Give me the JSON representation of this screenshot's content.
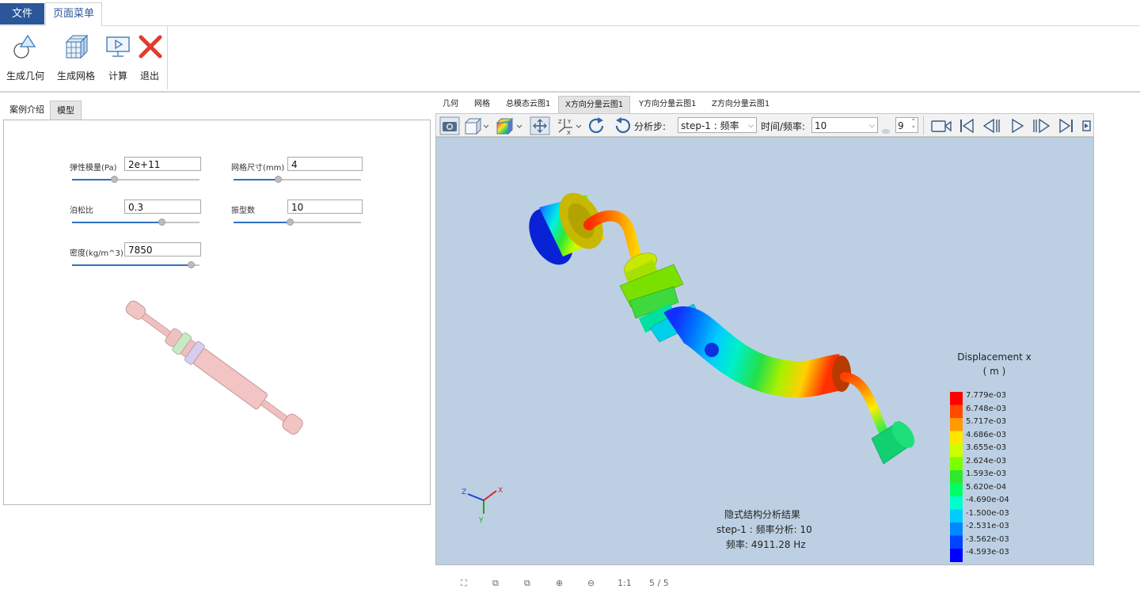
{
  "menu": {
    "file": "文件",
    "page_menu": "页面菜单"
  },
  "ribbon": {
    "buttons": [
      {
        "label": "生成几何",
        "icon": "geometry-icon"
      },
      {
        "label": "生成网格",
        "icon": "mesh-icon"
      },
      {
        "label": "计算",
        "icon": "compute-icon"
      },
      {
        "label": "退出",
        "icon": "exit-icon"
      }
    ]
  },
  "left": {
    "tabs": [
      "案例介绍",
      "模型"
    ],
    "active_tab": "模型",
    "params": {
      "elastic_modulus": {
        "label": "弹性模量(Pa)",
        "value": "2e+11",
        "slider": 0.32
      },
      "mesh_size": {
        "label": "网格尺寸(mm)",
        "value": "4",
        "slider": 0.34
      },
      "poisson": {
        "label": "泊松比",
        "value": "0.3",
        "slider": 0.72
      },
      "mode_count": {
        "label": "振型数",
        "value": "10",
        "slider": 0.44
      },
      "density": {
        "label": "密度(kg/m^3)",
        "value": "7850",
        "slider": 0.96
      }
    }
  },
  "view_tabs": [
    "几何",
    "网格",
    "总模态云图1",
    "X方向分量云图1",
    "Y方向分量云图1",
    "Z方向分量云图1"
  ],
  "active_view_tab": "X方向分量云图1",
  "toolbar": {
    "step_label": "分析步:",
    "step_value": "step-1 : 频率",
    "time_label": "时间/频率:",
    "time_value": "10",
    "frame_value": "9"
  },
  "legend": {
    "title": "Displacement x",
    "unit": "( m )",
    "values": [
      "7.779e-03",
      "6.748e-03",
      "5.717e-03",
      "4.686e-03",
      "3.655e-03",
      "2.624e-03",
      "1.593e-03",
      "5.620e-04",
      "-4.690e-04",
      "-1.500e-03",
      "-2.531e-03",
      "-3.562e-03",
      "-4.593e-03"
    ],
    "colors": [
      "#ff0000",
      "#ff4a00",
      "#ff9a00",
      "#ffe600",
      "#ccff00",
      "#7cff00",
      "#2ee82e",
      "#00ff66",
      "#00ffcc",
      "#00ccff",
      "#0088ff",
      "#0044ff",
      "#0000ff"
    ]
  },
  "result_info": {
    "line1": "隐式结构分析结果",
    "line2": "step-1 : 频率分析: 10",
    "line3": "频率:  4911.28 Hz"
  },
  "axes": {
    "x": "X",
    "y": "Y",
    "z": "Z"
  },
  "bottom_bar": {
    "page": "5 / 5",
    "ratio": "1:1"
  }
}
